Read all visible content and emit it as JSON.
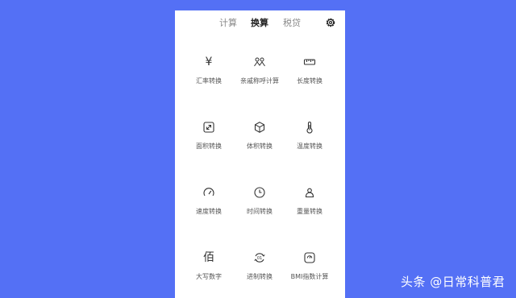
{
  "tabs": [
    {
      "label": "计算",
      "active": false
    },
    {
      "label": "换算",
      "active": true
    },
    {
      "label": "税贷",
      "active": false
    }
  ],
  "tools": [
    {
      "label": "汇率转换",
      "icon": "yen-icon",
      "glyph": "¥"
    },
    {
      "label": "亲戚称呼计算",
      "icon": "family-icon"
    },
    {
      "label": "长度转换",
      "icon": "ruler-icon"
    },
    {
      "label": "面积转换",
      "icon": "area-icon"
    },
    {
      "label": "体积转换",
      "icon": "cube-icon"
    },
    {
      "label": "温度转换",
      "icon": "thermometer-icon"
    },
    {
      "label": "速度转换",
      "icon": "speedometer-icon"
    },
    {
      "label": "时间转换",
      "icon": "clock-icon"
    },
    {
      "label": "重量转换",
      "icon": "weight-icon"
    },
    {
      "label": "大写数字",
      "icon": "bai-character-icon",
      "glyph": "佰"
    },
    {
      "label": "进制转换",
      "icon": "binary-icon"
    },
    {
      "label": "BMI指数计算",
      "icon": "scale-icon"
    }
  ],
  "watermark": "头条 @日常科普君",
  "colors": {
    "background": "#5470f5",
    "panel": "#ffffff",
    "active_tab": "#222222",
    "inactive_tab": "#8a8a8a"
  }
}
